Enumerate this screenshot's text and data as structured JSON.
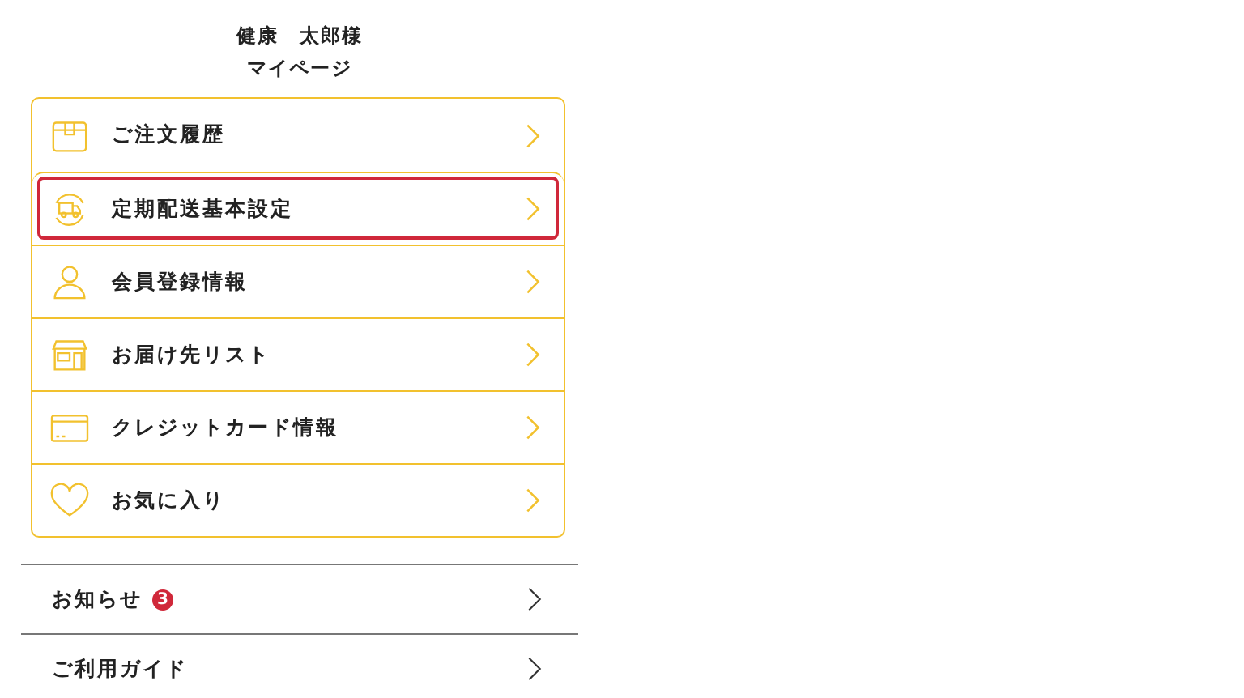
{
  "header": {
    "user_name": "健康　太郎様",
    "title": "マイページ"
  },
  "menu": [
    {
      "label": "ご注文履歴",
      "highlighted": false
    },
    {
      "label": "定期配送基本設定",
      "highlighted": true
    },
    {
      "label": "会員登録情報",
      "highlighted": false
    },
    {
      "label": "お届け先リスト",
      "highlighted": false
    },
    {
      "label": "クレジットカード情報",
      "highlighted": false
    },
    {
      "label": "お気に入り",
      "highlighted": false
    }
  ],
  "links": [
    {
      "label": "お知らせ",
      "badge": "3"
    },
    {
      "label": "ご利用ガイド"
    }
  ]
}
